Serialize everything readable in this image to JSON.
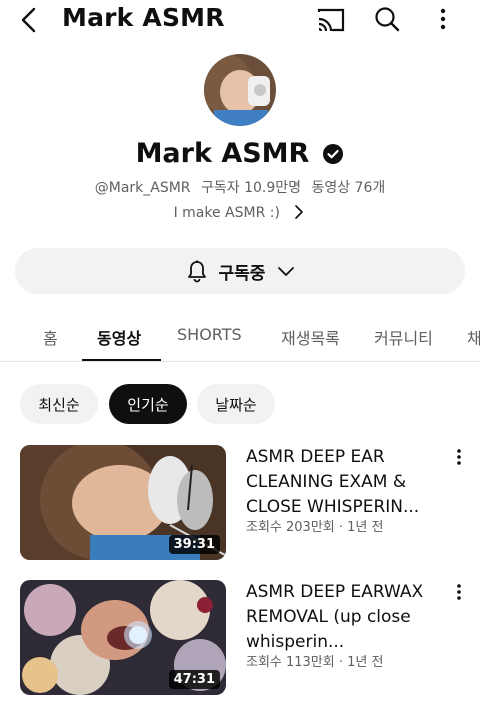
{
  "header": {
    "title": "Mark ASMR",
    "icons": [
      "back-arrow-icon",
      "cast-icon",
      "search-icon",
      "more-vertical-icon"
    ]
  },
  "channel": {
    "name": "Mark ASMR",
    "verified": true,
    "handle": "@Mark_ASMR",
    "subscribers": "구독자 10.9만명",
    "video_count": "동영상 76개",
    "description": "I make ASMR :)"
  },
  "subscribe": {
    "label": "구독중",
    "icon": "bell-icon"
  },
  "tabs": [
    {
      "label": "홈",
      "active": false
    },
    {
      "label": "동영상",
      "active": true
    },
    {
      "label": "SHORTS",
      "active": false
    },
    {
      "label": "재생목록",
      "active": false
    },
    {
      "label": "커뮤니티",
      "active": false
    },
    {
      "label": "채",
      "active": false
    }
  ],
  "sort_chips": [
    {
      "label": "최신순",
      "active": false
    },
    {
      "label": "인기순",
      "active": true
    },
    {
      "label": "날짜순",
      "active": false
    }
  ],
  "videos": [
    {
      "title": "ASMR DEEP EAR CLEANING EXAM & CLOSE WHISPERIN...",
      "meta": "조회수 203만회 · 1년 전",
      "duration": "39:31"
    },
    {
      "title": "ASMR DEEP EARWAX REMOVAL (up close whisperin...",
      "meta": "조회수 113만회 · 1년 전",
      "duration": "47:31"
    }
  ],
  "colors": {
    "text_primary": "#0f0f0f",
    "text_secondary": "#606060",
    "chip_background": "#f2f2f2",
    "chip_active": "#0f0f0f"
  }
}
